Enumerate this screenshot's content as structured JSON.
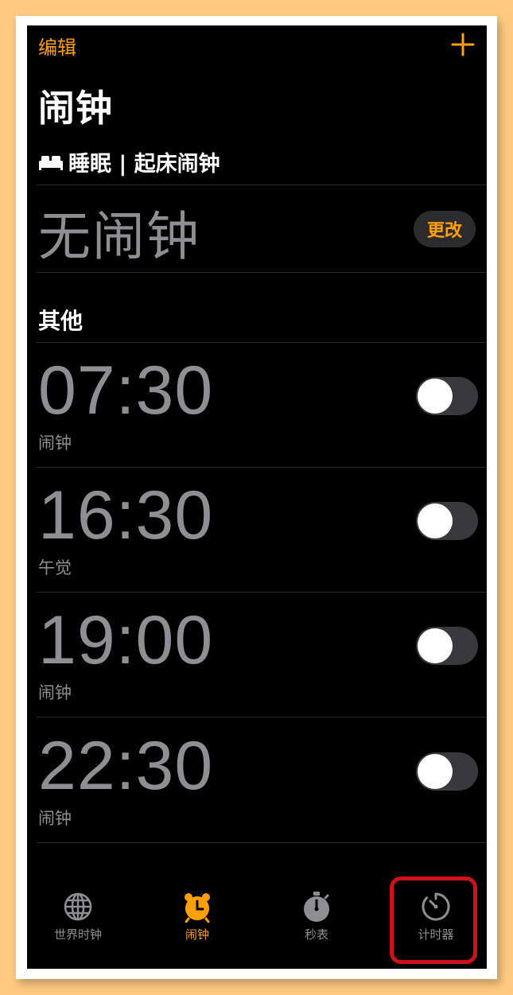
{
  "header": {
    "edit_label": "编辑",
    "title": "闹钟"
  },
  "sleep": {
    "header_label": "睡眠 | 起床闹钟",
    "no_alarm_text": "无闹钟",
    "change_label": "更改"
  },
  "other": {
    "header_label": "其他"
  },
  "alarms": [
    {
      "time": "07:30",
      "label": "闹钟",
      "enabled": false
    },
    {
      "time": "16:30",
      "label": "午觉",
      "enabled": false
    },
    {
      "time": "19:00",
      "label": "闹钟",
      "enabled": false
    },
    {
      "time": "22:30",
      "label": "闹钟",
      "enabled": false
    }
  ],
  "tabbar": {
    "tabs": [
      {
        "label": "世界时钟",
        "icon": "globe-icon",
        "active": false
      },
      {
        "label": "闹钟",
        "icon": "alarm-clock-icon",
        "active": true
      },
      {
        "label": "秒表",
        "icon": "stopwatch-icon",
        "active": false
      },
      {
        "label": "计时器",
        "icon": "timer-icon",
        "active": false,
        "highlighted": true
      }
    ]
  },
  "colors": {
    "accent": "#FF9F0A",
    "background": "#000000",
    "secondary_text": "#8E8E93",
    "highlight_border": "#D0101A",
    "page_border": "#FFCA80"
  }
}
